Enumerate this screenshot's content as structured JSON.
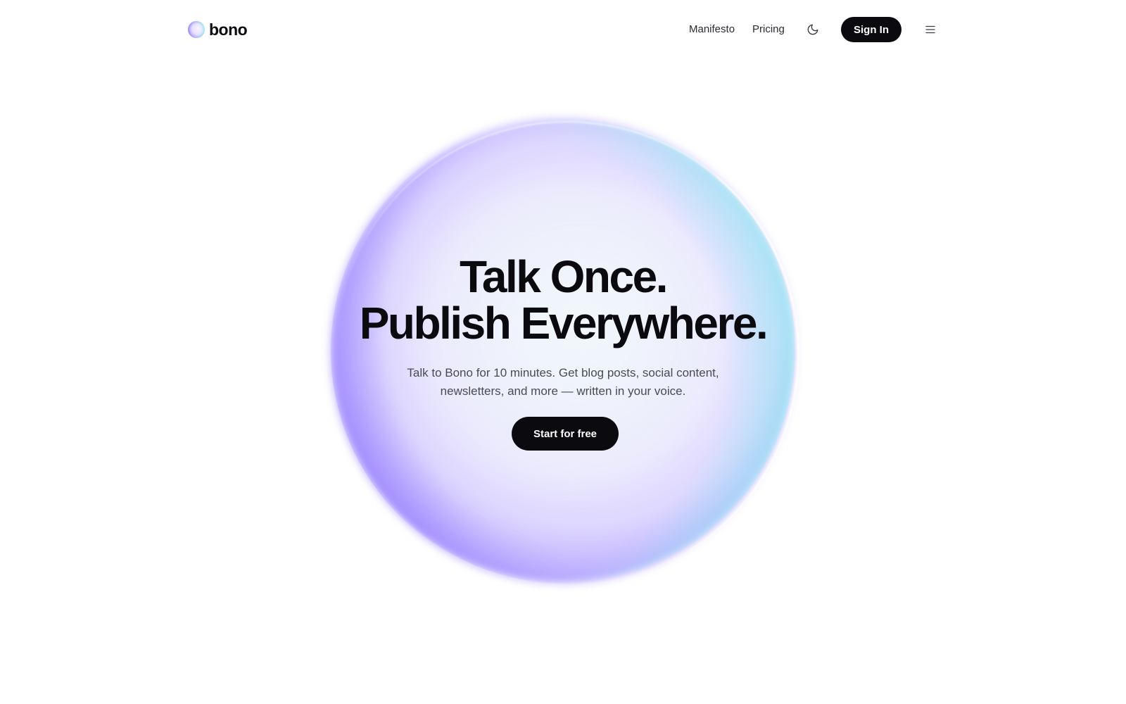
{
  "header": {
    "logo_text": "bono",
    "nav": {
      "manifesto": "Manifesto",
      "pricing": "Pricing"
    },
    "theme_icon": "moon-icon",
    "signin_label": "Sign In",
    "menu_icon": "hamburger-menu-icon"
  },
  "hero": {
    "title_line1": "Talk Once.",
    "title_line2": "Publish Everywhere.",
    "subtitle_line1": "Talk to Bono for 10 minutes. Get blog posts, social content,",
    "subtitle_line2": "newsletters, and more — written in your voice.",
    "cta_label": "Start for free"
  },
  "colors": {
    "primary": "#0b0b0f",
    "background": "#ffffff",
    "orb_violet": "#8f7bff",
    "orb_cyan": "#7ff5ea"
  }
}
